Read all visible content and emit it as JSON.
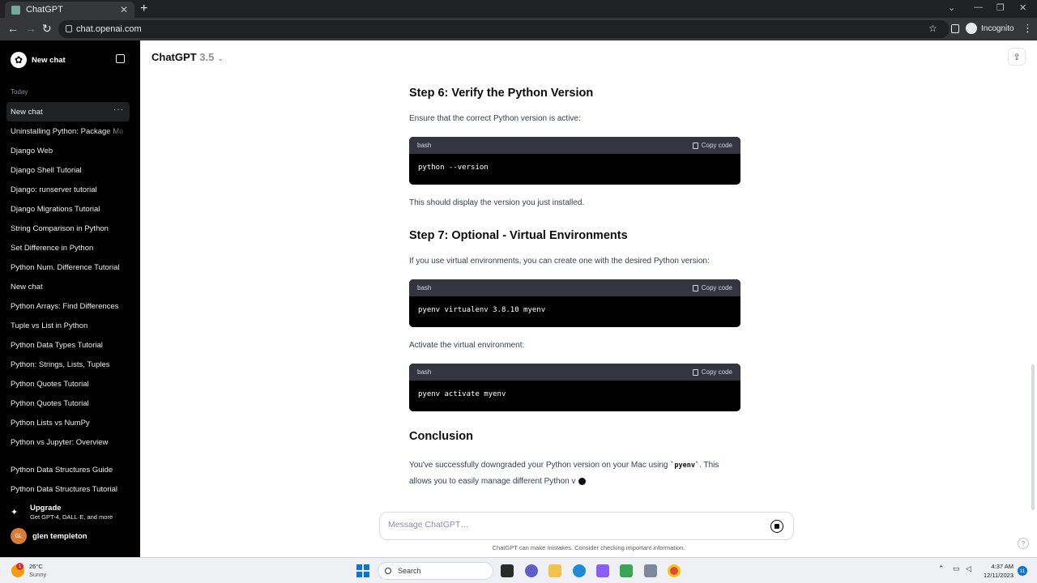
{
  "browser": {
    "tab_title": "ChatGPT",
    "url": "chat.openai.com",
    "incognito_label": "Incognito"
  },
  "sidebar": {
    "new_chat_label": "New chat",
    "section_today": "Today",
    "items": [
      {
        "label": "New chat",
        "active": true
      },
      {
        "label": "Uninstalling Python: Package Ma",
        "fade": true
      },
      {
        "label": "Django Web"
      },
      {
        "label": "Django Shell Tutorial"
      },
      {
        "label": "Django: runserver tutorial"
      },
      {
        "label": "Django Migrations Tutorial"
      },
      {
        "label": "String Comparison in Python"
      },
      {
        "label": "Set Difference in Python"
      },
      {
        "label": "Python Num. Difference Tutorial"
      },
      {
        "label": "New chat"
      },
      {
        "label": "Python Arrays: Find Differences"
      },
      {
        "label": "Tuple vs List in Python"
      },
      {
        "label": "Python Data Types Tutorial"
      },
      {
        "label": "Python: Strings, Lists, Tuples"
      },
      {
        "label": "Python Quotes Tutorial"
      },
      {
        "label": "Python Quotes Tutorial"
      },
      {
        "label": "Python Lists vs NumPy"
      },
      {
        "label": "Python vs Jupyter: Overview"
      }
    ],
    "items_lower": [
      {
        "label": "Python Data Structures Guide"
      },
      {
        "label": "Python Data Structures Tutorial"
      }
    ],
    "upgrade_title": "Upgrade",
    "upgrade_sub": "Get GPT-4, DALL·E, and more",
    "user_initials": "GL",
    "user_name": "glen templeton"
  },
  "header": {
    "model_name": "ChatGPT",
    "model_version": "3.5"
  },
  "content": {
    "step6_heading": "Step 6: Verify the Python Version",
    "step6_text": "Ensure that the correct Python version is active:",
    "code1_lang": "bash",
    "code1": "python --version",
    "after_code1": "This should display the version you just installed.",
    "step7_heading": "Step 7: Optional - Virtual Environments",
    "step7_text": "If you use virtual environments, you can create one with the desired Python version:",
    "code2_lang": "bash",
    "code2": "pyenv virtualenv 3.8.10 myenv",
    "activate_text": "Activate the virtual environment:",
    "code3_lang": "bash",
    "code3": "pyenv activate myenv",
    "copy_label": "Copy code",
    "conclusion_heading": "Conclusion",
    "conclusion_part1": "You've successfully downgraded your Python version on your Mac using ",
    "conclusion_code": "`pyenv`",
    "conclusion_part2": ". This",
    "conclusion_line2": "allows you to easily manage different Python v"
  },
  "composer": {
    "placeholder": "Message ChatGPT…",
    "disclaimer": "ChatGPT can make mistakes. Consider checking important information.",
    "help_label": "?"
  },
  "taskbar": {
    "temp": "26°C",
    "condition": "Sunny",
    "weather_badge": "1",
    "search_label": "Search",
    "time": "4:37 AM",
    "date": "12/11/2023",
    "notif_count": "11"
  }
}
